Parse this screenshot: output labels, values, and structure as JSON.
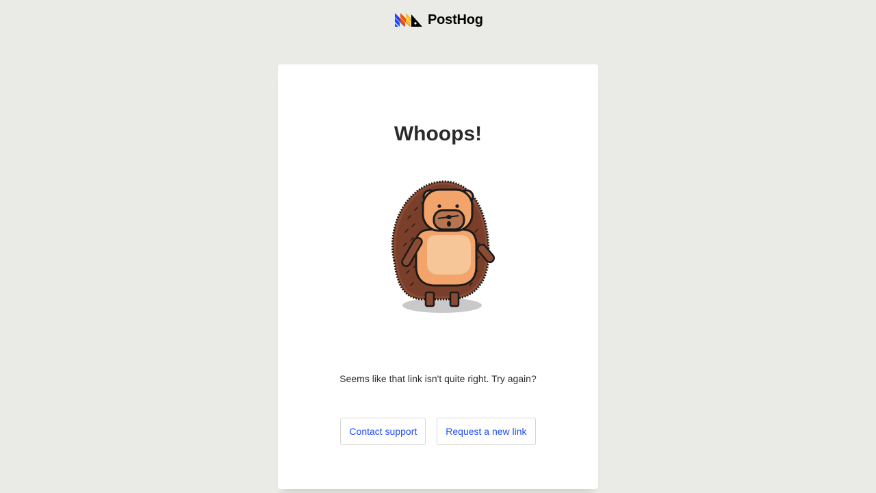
{
  "brand": {
    "name": "PostHog",
    "logo_icon": "posthog-logo-icon"
  },
  "card": {
    "title": "Whoops!",
    "illustration": "hedgehog-illustration",
    "message": "Seems like that link isn't quite right. Try again?"
  },
  "actions": {
    "contact_support": "Contact support",
    "request_new_link": "Request a new link"
  },
  "colors": {
    "page_background": "#eaebe6",
    "card_background": "#ffffff",
    "link_blue": "#1d4aff",
    "logo_blue": "#1d4aff",
    "logo_orange": "#f54e00",
    "logo_yellow": "#f9bd2b"
  }
}
